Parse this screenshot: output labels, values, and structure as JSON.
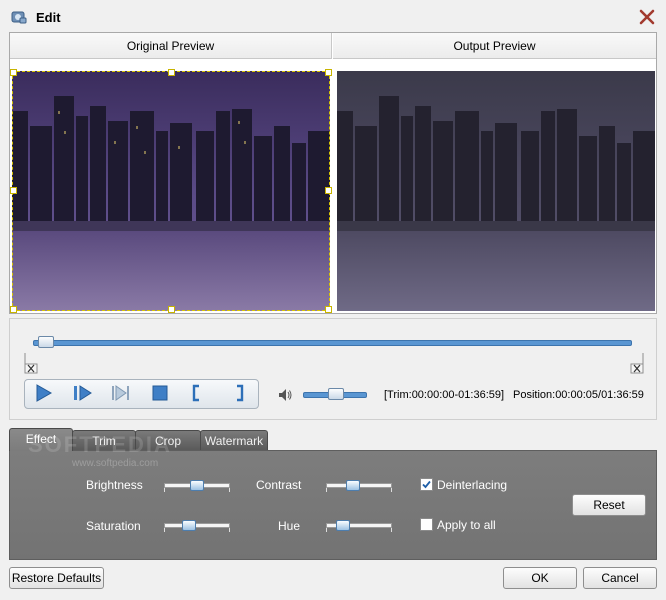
{
  "window": {
    "title": "Edit"
  },
  "preview": {
    "original_label": "Original Preview",
    "output_label": "Output Preview"
  },
  "playback": {
    "trim_text": "[Trim:00:00:00-01:36:59]",
    "position_text": "Position:00:00:05/01:36:59",
    "progress": 0.01,
    "volume": 0.5
  },
  "tabs": [
    {
      "label": "Effect",
      "active": true
    },
    {
      "label": "Trim",
      "active": false
    },
    {
      "label": "Crop",
      "active": false
    },
    {
      "label": "Watermark",
      "active": false
    }
  ],
  "watermark": {
    "brand": "SOFTPEDIA",
    "url": "www.softpedia.com"
  },
  "effects": {
    "brightness": {
      "label": "Brightness",
      "value": 0.5
    },
    "contrast": {
      "label": "Contrast",
      "value": 0.38
    },
    "saturation": {
      "label": "Saturation",
      "value": 0.35
    },
    "hue": {
      "label": "Hue",
      "value": 0.2
    },
    "deinterlacing": {
      "label": "Deinterlacing",
      "checked": true
    },
    "apply_to_all": {
      "label": "Apply to all",
      "checked": false
    },
    "reset_label": "Reset"
  },
  "footer": {
    "restore_label": "Restore Defaults",
    "ok_label": "OK",
    "cancel_label": "Cancel"
  },
  "colors": {
    "accent": "#5a96d2",
    "panel": "#777777",
    "close": "#a23a2e"
  }
}
